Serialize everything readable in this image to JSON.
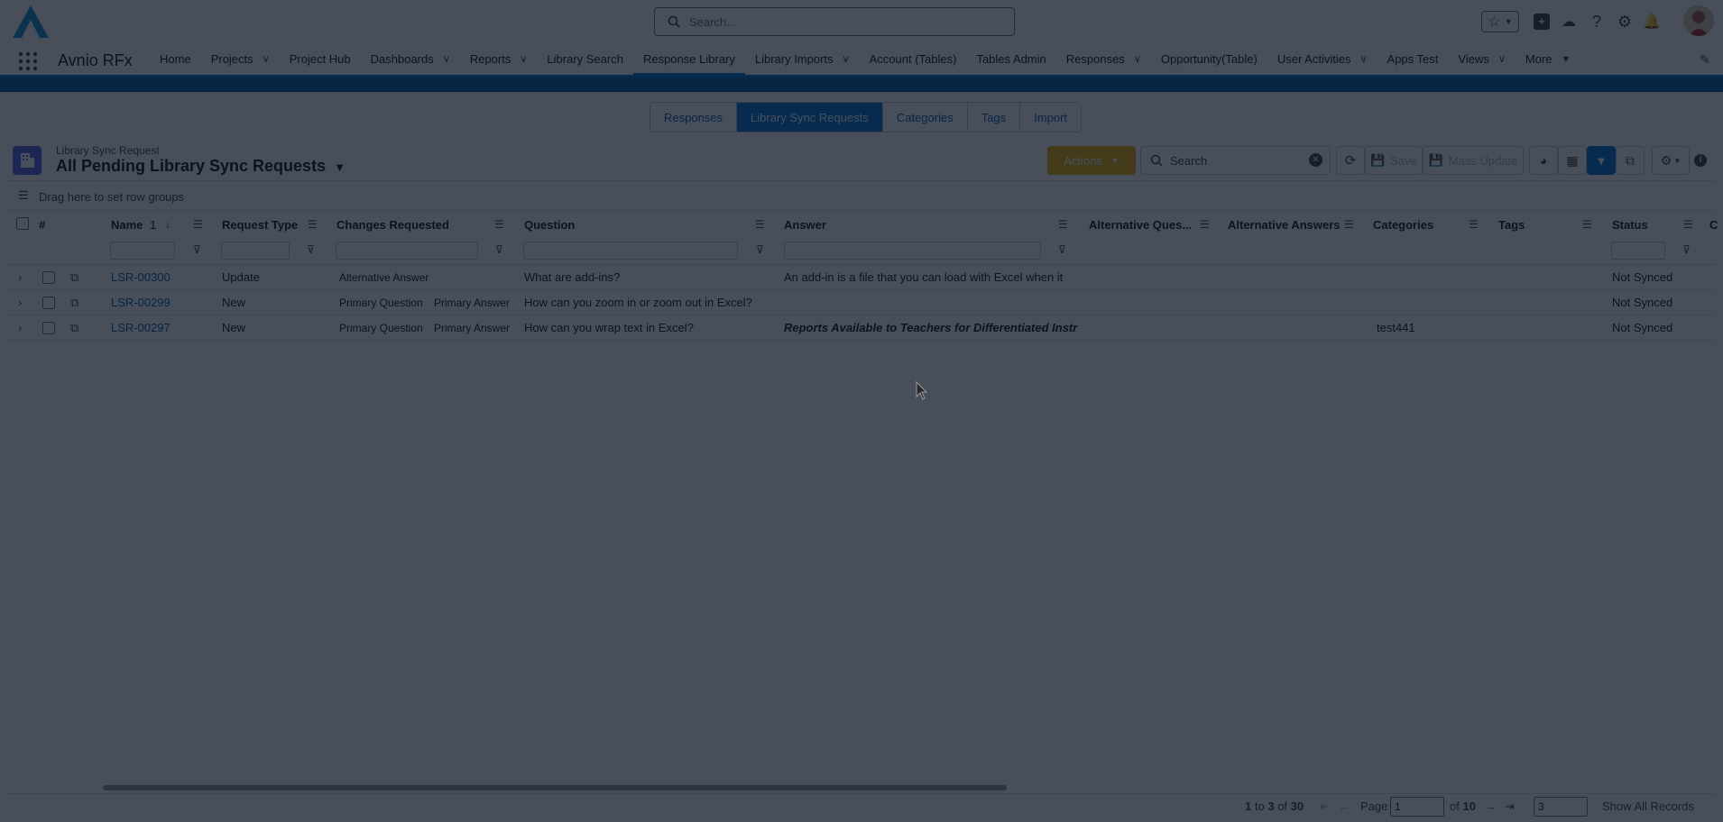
{
  "topbar": {
    "search_placeholder": "Search..."
  },
  "nav": {
    "app_name": "Avnio RFx",
    "items": [
      {
        "label": "Home",
        "chevron": false
      },
      {
        "label": "Projects",
        "chevron": true
      },
      {
        "label": "Project Hub",
        "chevron": false
      },
      {
        "label": "Dashboards",
        "chevron": true
      },
      {
        "label": "Reports",
        "chevron": true
      },
      {
        "label": "Library Search",
        "chevron": false
      },
      {
        "label": "Response Library",
        "chevron": false,
        "active": true
      },
      {
        "label": "Library Imports",
        "chevron": true
      },
      {
        "label": "Account (Tables)",
        "chevron": false
      },
      {
        "label": "Tables Admin",
        "chevron": false
      },
      {
        "label": "Responses",
        "chevron": true
      },
      {
        "label": "Opportunity(Table)",
        "chevron": false
      },
      {
        "label": "User Activities",
        "chevron": true
      },
      {
        "label": "Apps Test",
        "chevron": false
      },
      {
        "label": "Views",
        "chevron": true
      },
      {
        "label": "More",
        "chevron": true
      }
    ]
  },
  "subtabs": [
    {
      "label": "Responses"
    },
    {
      "label": "Library Sync Requests",
      "active": true
    },
    {
      "label": "Categories"
    },
    {
      "label": "Tags"
    },
    {
      "label": "Import"
    }
  ],
  "listview": {
    "object_label": "Library Sync Request",
    "title": "All Pending Library Sync Requests",
    "actions_label": "Actions",
    "search_placeholder": "Search",
    "save_label": "Save",
    "mass_update_label": "Mass Update",
    "group_hint": "Drag here to set row groups"
  },
  "table": {
    "headers": {
      "rownum": "#",
      "name": "Name",
      "sort_index": "1",
      "request_type": "Request Type",
      "changes": "Changes Requested",
      "question": "Question",
      "answer": "Answer",
      "alt_questions": "Alternative Ques...",
      "alt_answers": "Alternative Answers",
      "categories": "Categories",
      "tags": "Tags",
      "status": "Status",
      "extra": "C"
    },
    "rows": [
      {
        "name": "LSR-00300",
        "request_type": "Update",
        "changes": [
          "Alternative Answer"
        ],
        "question": "What are add-ins?",
        "answer": "An add-in is a file that you can load with Excel when it",
        "categories": "",
        "status": "Not Synced"
      },
      {
        "name": "LSR-00299",
        "request_type": "New",
        "changes": [
          "Primary Question",
          "Primary Answer"
        ],
        "question": "How can you zoom in or zoom out in Excel?",
        "answer": "",
        "categories": "",
        "status": "Not Synced"
      },
      {
        "name": "LSR-00297",
        "request_type": "New",
        "changes": [
          "Primary Question",
          "Primary Answer"
        ],
        "question": "How can you wrap text in Excel?",
        "answer": "Reports Available to Teachers for Differentiated Instr",
        "categories": "test441",
        "status": "Not Synced"
      }
    ]
  },
  "pagination": {
    "range_start": "1",
    "to_word": "to",
    "range_end": "3",
    "of_word": "of",
    "total": "30",
    "page_label": "Page",
    "page_value": "1",
    "of_pages_label": "of",
    "page_count": "10",
    "page_size": "3",
    "show_all": "Show All Records"
  },
  "colors": {
    "brand": "#0176d3",
    "overlay": "rgba(8,18,32,0.74)",
    "actions": "#eab308"
  }
}
